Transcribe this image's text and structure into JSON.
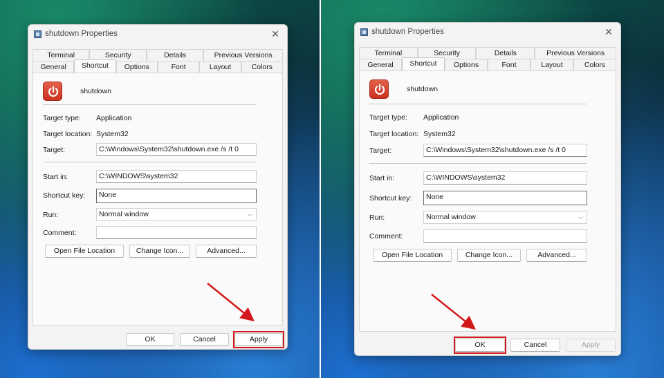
{
  "dialog": {
    "title": "shutdown Properties",
    "close_glyph": "✕",
    "tabs_row1": [
      "Terminal",
      "Security",
      "Details",
      "Previous Versions"
    ],
    "tabs_row2": [
      "General",
      "Shortcut",
      "Options",
      "Font",
      "Layout",
      "Colors"
    ],
    "active_tab": "Shortcut",
    "app_name": "shutdown",
    "fields": {
      "target_type_label": "Target type:",
      "target_type_value": "Application",
      "target_location_label": "Target location:",
      "target_location_value": "System32",
      "target_label": "Target:",
      "target_value": "C:\\Windows\\System32\\shutdown.exe /s /t 0",
      "start_in_label": "Start in:",
      "start_in_value": "C:\\WINDOWS\\system32",
      "shortcut_key_label": "Shortcut key:",
      "shortcut_key_value": "None",
      "run_label": "Run:",
      "run_value": "Normal window",
      "comment_label": "Comment:",
      "comment_value": ""
    },
    "buttons": {
      "open_file_location": "Open File Location",
      "change_icon": "Change Icon...",
      "advanced": "Advanced...",
      "ok": "OK",
      "cancel": "Cancel",
      "apply": "Apply"
    }
  },
  "highlight_color": "#d3171a",
  "icons": {
    "app": "power-icon",
    "title": "shortcut-properties-icon",
    "close": "close-icon",
    "dropdown": "chevron-down-icon"
  }
}
